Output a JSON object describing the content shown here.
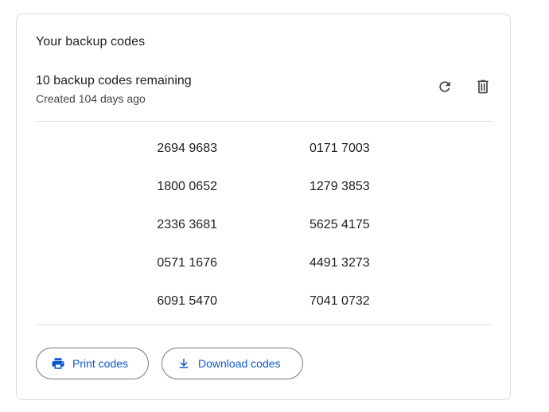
{
  "card": {
    "title": "Your backup codes",
    "summary_main": "10 backup codes remaining",
    "summary_sub": "Created 104 days ago",
    "refresh_icon": "refresh-icon",
    "delete_icon": "trash-icon"
  },
  "codes": [
    {
      "left": "2694 9683",
      "right": "0171 7003"
    },
    {
      "left": "1800 0652",
      "right": "1279 3853"
    },
    {
      "left": "2336 3681",
      "right": "5625 4175"
    },
    {
      "left": "0571 1676",
      "right": "4491 3273"
    },
    {
      "left": "6091 5470",
      "right": "7041 0732"
    }
  ],
  "actions": {
    "print_label": "Print codes",
    "print_icon": "printer-icon",
    "download_label": "Download codes",
    "download_icon": "download-icon"
  },
  "colors": {
    "accent": "#0b57d0",
    "border": "#dadce0",
    "text": "#1f1f1f",
    "secondary_text": "#444746",
    "icon": "#444746"
  }
}
